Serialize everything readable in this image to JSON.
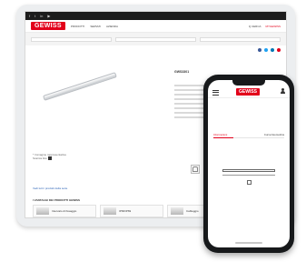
{
  "tablet": {
    "logo": "GEWISS",
    "nav": [
      "PRODOTTI",
      "SERVIZI",
      "AZIENDA"
    ],
    "nav_right": {
      "search": "Q CERCA",
      "login": "MYGEWISS"
    },
    "product_code": "GWS3301",
    "note": "* Immagine rappresentativa",
    "download": "Scarica foto",
    "all_products_link": "Vedi tutti i prodotti della serie",
    "advantages_title": "I VANTAGGI DEI PRODOTTI GEWISS",
    "cards": [
      "Intervalo di fissaggio",
      "IP66/IP69",
      "Cablaggio"
    ]
  },
  "phone": {
    "logo": "GEWISS",
    "tabs": [
      "Informazioni",
      "Curva fotometrica"
    ]
  },
  "colors": {
    "brand": "#e2001a",
    "link": "#2a62b6"
  }
}
